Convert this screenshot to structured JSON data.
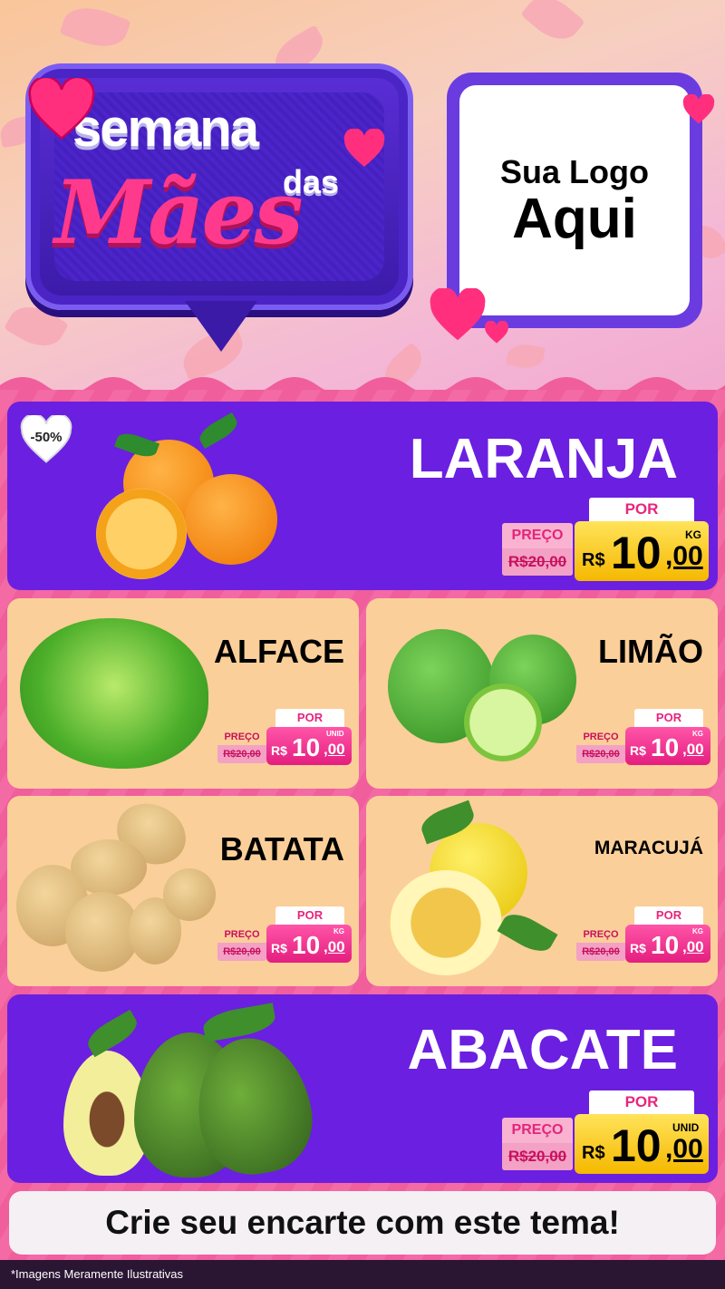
{
  "header": {
    "title_line1": "semana",
    "title_line2": "das",
    "title_line3": "Mães",
    "logo_line1": "Sua Logo",
    "logo_line2": "Aqui"
  },
  "badge": {
    "discount": "-50%"
  },
  "products": [
    {
      "name": "LARANJA",
      "por": "POR",
      "preco_label": "PREÇO",
      "old_price": "R$20,00",
      "currency": "R$",
      "price_int": "10",
      "price_dec": ",00",
      "unit": "KG"
    },
    {
      "name": "ALFACE",
      "por": "POR",
      "preco_label": "PREÇO",
      "old_price": "R$20,00",
      "currency": "R$",
      "price_int": "10",
      "price_dec": ",00",
      "unit": "UNID"
    },
    {
      "name": "LIMÃO",
      "por": "POR",
      "preco_label": "PREÇO",
      "old_price": "R$20,00",
      "currency": "R$",
      "price_int": "10",
      "price_dec": ",00",
      "unit": "KG"
    },
    {
      "name": "BATATA",
      "por": "POR",
      "preco_label": "PREÇO",
      "old_price": "R$20,00",
      "currency": "R$",
      "price_int": "10",
      "price_dec": ",00",
      "unit": "KG"
    },
    {
      "name": "MARACUJÁ",
      "por": "POR",
      "preco_label": "PREÇO",
      "old_price": "R$20,00",
      "currency": "R$",
      "price_int": "10",
      "price_dec": ",00",
      "unit": "KG"
    },
    {
      "name": "ABACATE",
      "por": "POR",
      "preco_label": "PREÇO",
      "old_price": "R$20,00",
      "currency": "R$",
      "price_int": "10",
      "price_dec": ",00",
      "unit": "UNID"
    }
  ],
  "cta": "Crie seu encarte com este tema!",
  "footer": "*Imagens Meramente Ilustrativas",
  "colors": {
    "purple": "#6b1fe0",
    "pink": "#e8247e",
    "gold": "#f5b800",
    "peach": "#fbcf99"
  }
}
